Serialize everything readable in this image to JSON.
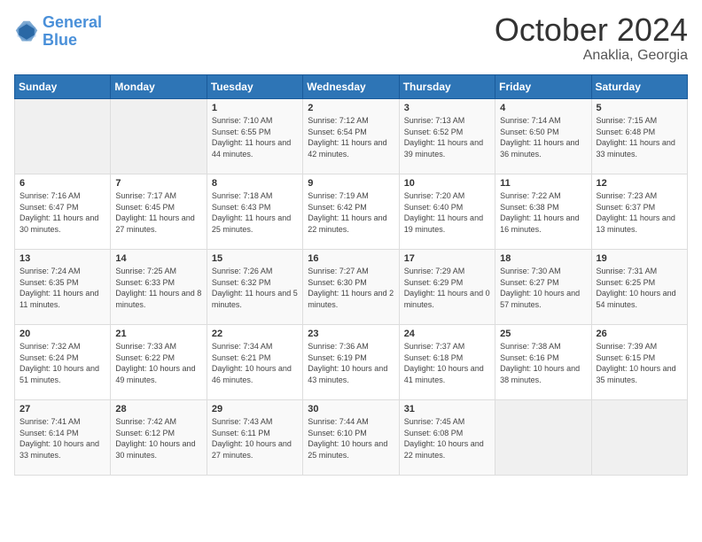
{
  "logo": {
    "line1": "General",
    "line2": "Blue"
  },
  "header": {
    "month": "October 2024",
    "location": "Anaklia, Georgia"
  },
  "weekdays": [
    "Sunday",
    "Monday",
    "Tuesday",
    "Wednesday",
    "Thursday",
    "Friday",
    "Saturday"
  ],
  "weeks": [
    [
      {
        "day": "",
        "info": ""
      },
      {
        "day": "",
        "info": ""
      },
      {
        "day": "1",
        "info": "Sunrise: 7:10 AM\nSunset: 6:55 PM\nDaylight: 11 hours and 44 minutes."
      },
      {
        "day": "2",
        "info": "Sunrise: 7:12 AM\nSunset: 6:54 PM\nDaylight: 11 hours and 42 minutes."
      },
      {
        "day": "3",
        "info": "Sunrise: 7:13 AM\nSunset: 6:52 PM\nDaylight: 11 hours and 39 minutes."
      },
      {
        "day": "4",
        "info": "Sunrise: 7:14 AM\nSunset: 6:50 PM\nDaylight: 11 hours and 36 minutes."
      },
      {
        "day": "5",
        "info": "Sunrise: 7:15 AM\nSunset: 6:48 PM\nDaylight: 11 hours and 33 minutes."
      }
    ],
    [
      {
        "day": "6",
        "info": "Sunrise: 7:16 AM\nSunset: 6:47 PM\nDaylight: 11 hours and 30 minutes."
      },
      {
        "day": "7",
        "info": "Sunrise: 7:17 AM\nSunset: 6:45 PM\nDaylight: 11 hours and 27 minutes."
      },
      {
        "day": "8",
        "info": "Sunrise: 7:18 AM\nSunset: 6:43 PM\nDaylight: 11 hours and 25 minutes."
      },
      {
        "day": "9",
        "info": "Sunrise: 7:19 AM\nSunset: 6:42 PM\nDaylight: 11 hours and 22 minutes."
      },
      {
        "day": "10",
        "info": "Sunrise: 7:20 AM\nSunset: 6:40 PM\nDaylight: 11 hours and 19 minutes."
      },
      {
        "day": "11",
        "info": "Sunrise: 7:22 AM\nSunset: 6:38 PM\nDaylight: 11 hours and 16 minutes."
      },
      {
        "day": "12",
        "info": "Sunrise: 7:23 AM\nSunset: 6:37 PM\nDaylight: 11 hours and 13 minutes."
      }
    ],
    [
      {
        "day": "13",
        "info": "Sunrise: 7:24 AM\nSunset: 6:35 PM\nDaylight: 11 hours and 11 minutes."
      },
      {
        "day": "14",
        "info": "Sunrise: 7:25 AM\nSunset: 6:33 PM\nDaylight: 11 hours and 8 minutes."
      },
      {
        "day": "15",
        "info": "Sunrise: 7:26 AM\nSunset: 6:32 PM\nDaylight: 11 hours and 5 minutes."
      },
      {
        "day": "16",
        "info": "Sunrise: 7:27 AM\nSunset: 6:30 PM\nDaylight: 11 hours and 2 minutes."
      },
      {
        "day": "17",
        "info": "Sunrise: 7:29 AM\nSunset: 6:29 PM\nDaylight: 11 hours and 0 minutes."
      },
      {
        "day": "18",
        "info": "Sunrise: 7:30 AM\nSunset: 6:27 PM\nDaylight: 10 hours and 57 minutes."
      },
      {
        "day": "19",
        "info": "Sunrise: 7:31 AM\nSunset: 6:25 PM\nDaylight: 10 hours and 54 minutes."
      }
    ],
    [
      {
        "day": "20",
        "info": "Sunrise: 7:32 AM\nSunset: 6:24 PM\nDaylight: 10 hours and 51 minutes."
      },
      {
        "day": "21",
        "info": "Sunrise: 7:33 AM\nSunset: 6:22 PM\nDaylight: 10 hours and 49 minutes."
      },
      {
        "day": "22",
        "info": "Sunrise: 7:34 AM\nSunset: 6:21 PM\nDaylight: 10 hours and 46 minutes."
      },
      {
        "day": "23",
        "info": "Sunrise: 7:36 AM\nSunset: 6:19 PM\nDaylight: 10 hours and 43 minutes."
      },
      {
        "day": "24",
        "info": "Sunrise: 7:37 AM\nSunset: 6:18 PM\nDaylight: 10 hours and 41 minutes."
      },
      {
        "day": "25",
        "info": "Sunrise: 7:38 AM\nSunset: 6:16 PM\nDaylight: 10 hours and 38 minutes."
      },
      {
        "day": "26",
        "info": "Sunrise: 7:39 AM\nSunset: 6:15 PM\nDaylight: 10 hours and 35 minutes."
      }
    ],
    [
      {
        "day": "27",
        "info": "Sunrise: 7:41 AM\nSunset: 6:14 PM\nDaylight: 10 hours and 33 minutes."
      },
      {
        "day": "28",
        "info": "Sunrise: 7:42 AM\nSunset: 6:12 PM\nDaylight: 10 hours and 30 minutes."
      },
      {
        "day": "29",
        "info": "Sunrise: 7:43 AM\nSunset: 6:11 PM\nDaylight: 10 hours and 27 minutes."
      },
      {
        "day": "30",
        "info": "Sunrise: 7:44 AM\nSunset: 6:10 PM\nDaylight: 10 hours and 25 minutes."
      },
      {
        "day": "31",
        "info": "Sunrise: 7:45 AM\nSunset: 6:08 PM\nDaylight: 10 hours and 22 minutes."
      },
      {
        "day": "",
        "info": ""
      },
      {
        "day": "",
        "info": ""
      }
    ]
  ]
}
